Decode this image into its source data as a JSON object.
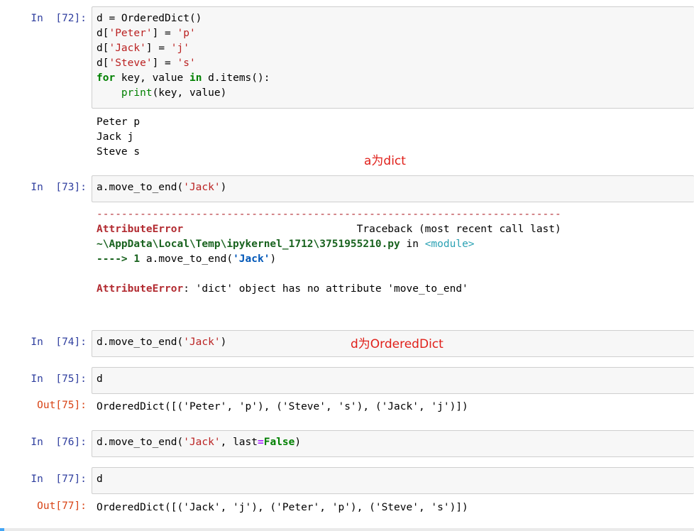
{
  "cells": {
    "c72": {
      "prompt": "In  [72]:",
      "lines": {
        "l1": "d = OrderedDict()",
        "l2a": "d[",
        "l2b": "'Peter'",
        "l2c": "] = ",
        "l2d": "'p'",
        "l3a": "d[",
        "l3b": "'Jack'",
        "l3c": "] = ",
        "l3d": "'j'",
        "l4a": "d[",
        "l4b": "'Steve'",
        "l4c": "] = ",
        "l4d": "'s'",
        "l5a": "for",
        "l5b": " key, value ",
        "l5c": "in",
        "l5d": " d.items():",
        "l6a": "    ",
        "l6b": "print",
        "l6c": "(key, value)"
      },
      "output": [
        "Peter p",
        "Jack j",
        "Steve s"
      ]
    },
    "c73": {
      "prompt": "In  [73]:",
      "code_a": "a.move_to_end(",
      "code_b": "'Jack'",
      "code_c": ")",
      "traceback": {
        "dashes": "---------------------------------------------------------------------------",
        "err_name": "AttributeError",
        "spacer": "                            ",
        "header": "Traceback (most recent call last)",
        "path": "~\\AppData\\Local\\Temp\\ipykernel_1712\\3751955210.py",
        "in_word": " in ",
        "module": "<module>",
        "arrow": "---->",
        "lineno": " 1 ",
        "code_a": "a.move_to_end(",
        "code_b": "'Jack'",
        "code_c": ")",
        "err_label": "AttributeError",
        "err_msg": ": 'dict' object has no attribute 'move_to_end'"
      }
    },
    "c74": {
      "prompt": "In  [74]:",
      "code_a": "d.move_to_end(",
      "code_b": "'Jack'",
      "code_c": ")"
    },
    "c75": {
      "prompt": "In  [75]:",
      "code": "d",
      "out_prompt": "Out[75]:",
      "output": "OrderedDict([('Peter', 'p'), ('Steve', 's'), ('Jack', 'j')])"
    },
    "c76": {
      "prompt": "In  [76]:",
      "code_a": "d.move_to_end(",
      "code_b": "'Jack'",
      "code_c": ", last",
      "code_d": "=",
      "code_e": "False",
      "code_f": ")"
    },
    "c77": {
      "prompt": "In  [77]:",
      "code": "d",
      "out_prompt": "Out[77]:",
      "output": "OrderedDict([('Jack', 'j'), ('Peter', 'p'), ('Steve', 's')])"
    }
  },
  "annotations": {
    "a_is_dict": "a为dict",
    "d_is_ordereddict": "d为OrderedDict"
  },
  "colors": {
    "in_prompt": "#303f9f",
    "out_prompt": "#d84315",
    "annotation": "#e0201a",
    "string": "#ba2121",
    "keyword": "#008000"
  }
}
